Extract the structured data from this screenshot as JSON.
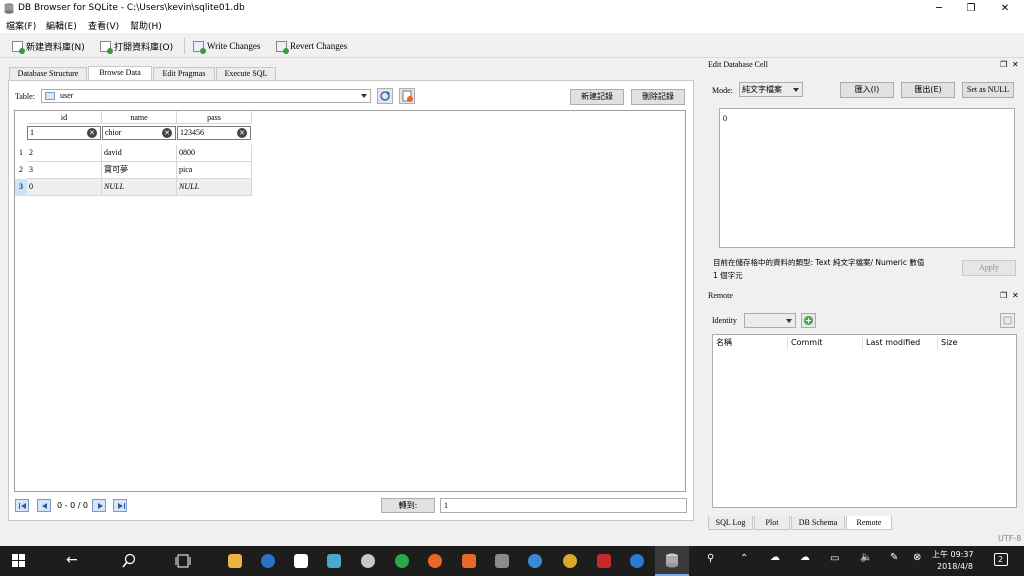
{
  "window": {
    "title": "DB Browser for SQLite - C:\\Users\\kevin\\sqlite01.db"
  },
  "menu": [
    "檔案(F)",
    "編輯(E)",
    "查看(V)",
    "幫助(H)"
  ],
  "toolbar": {
    "new_db": "新建資料庫(N)",
    "open_db": "打開資料庫(O)",
    "write": "Write Changes",
    "revert": "Revert Changes"
  },
  "tabs": [
    "Database Structure",
    "Browse Data",
    "Edit Pragmas",
    "Execute SQL"
  ],
  "browse": {
    "table_label": "Table:",
    "table_value": "user",
    "new_record": "新建記錄",
    "delete_record": "刪除記錄",
    "columns": [
      "id",
      "name",
      "pass"
    ],
    "filters": [
      "1",
      "chior",
      "123456"
    ],
    "rows": [
      {
        "num": "1",
        "id": "2",
        "name": "david",
        "pass": "0800"
      },
      {
        "num": "2",
        "id": "3",
        "name": "寶可夢",
        "pass": "pica"
      },
      {
        "num": "3",
        "id": "0",
        "name": "NULL",
        "pass": "NULL"
      }
    ],
    "nav_count": "0 - 0 / 0",
    "goto_label": "轉到:",
    "goto_value": "1"
  },
  "edit_cell": {
    "title": "Edit Database Cell",
    "mode_label": "Mode:",
    "mode_value": "純文字檔案",
    "import": "匯入(I)",
    "export": "匯出(E)",
    "set_null": "Set as NULL",
    "value": "0",
    "info_line1": "目前在儲存格中的資料的類型: Text 純文字檔案/ Numeric 數值",
    "info_line2": "1 個字元",
    "apply": "Apply"
  },
  "remote": {
    "title": "Remote",
    "identity_label": "Identity",
    "columns": [
      "名稱",
      "Commit",
      "Last modified",
      "Size"
    ]
  },
  "dock_tabs": [
    "SQL Log",
    "Plot",
    "DB Schema",
    "Remote"
  ],
  "status": {
    "encoding": "UTF-8"
  },
  "taskbar": {
    "time": "上午 09:37",
    "date": "2018/4/8",
    "notif_count": "2"
  }
}
